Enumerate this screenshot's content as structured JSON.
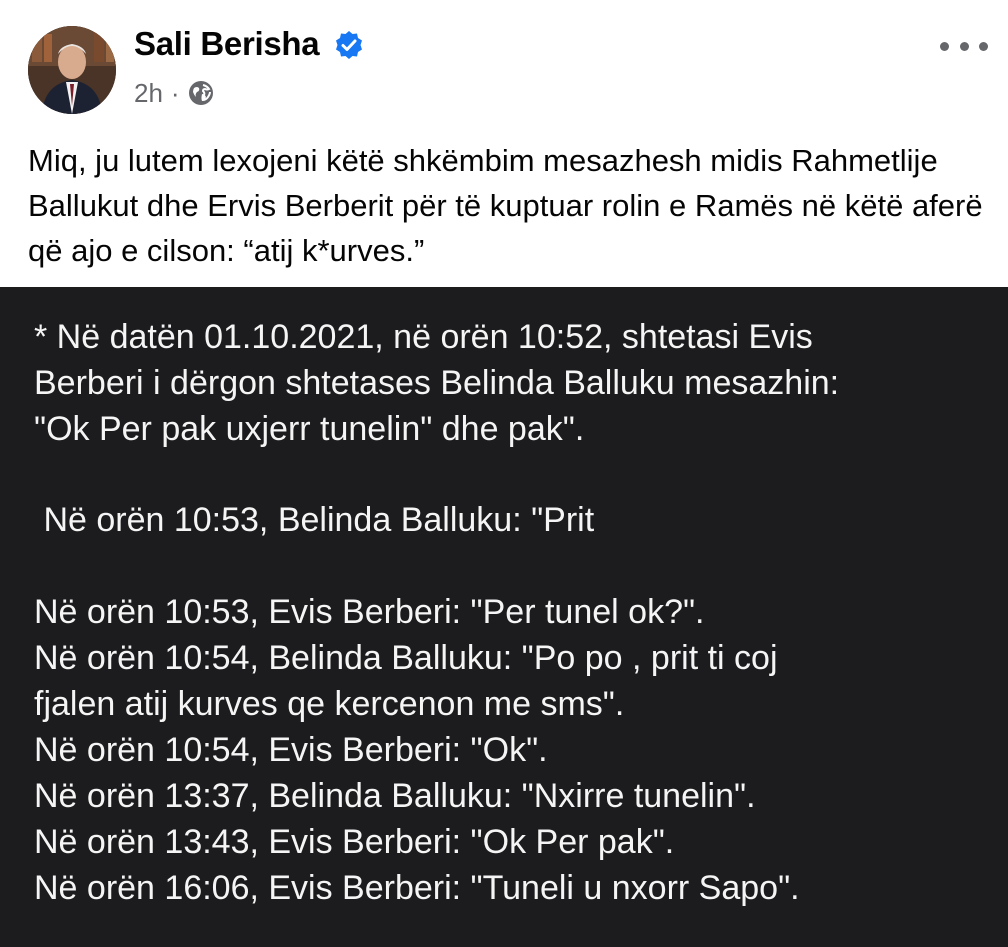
{
  "post": {
    "author": "Sali Berisha",
    "time": "2h",
    "separator": "·",
    "caption": "Miq, ju lutem lexojeni këtë shkëmbim mesazhesh midis Rahmetlije Ballukut dhe Ervis Berberit për të kuptuar rolin e Ramës në këtë aferë që ajo e cilson: “atij k*urves.”",
    "icons": {
      "verified": "verified-badge-icon",
      "audience": "globe-icon",
      "menu": "more-options-icon"
    },
    "colors": {
      "verified": "#1877f2",
      "meta": "#65676b",
      "image_background": "#1c1c1e"
    }
  },
  "image_text": {
    "lines": [
      "* Në datën 01.10.2021, në orën 10:52, shtetasi Evis",
      "Berberi i dërgon shtetases Belinda Balluku mesazhin:",
      "\"Ok Per pak uxjerr tunelin\" dhe pak\".",
      " Në orën 10:53, Belinda Balluku: \"Prit",
      "Në orën 10:53, Evis Berberi: \"Per tunel ok?\".",
      "Në orën 10:54, Belinda Balluku: \"Po po , prit ti coj",
      "fjalen atij kurves qe kercenon me sms\".",
      "Në orën 10:54, Evis Berberi: \"Ok\".",
      "Në orën 13:37, Belinda Balluku: \"Nxirre tunelin\".",
      "Në orën 13:43, Evis Berberi: \"Ok Per pak\".",
      "Në orën 16:06, Evis Berberi: \"Tuneli u nxorr Sapo\"."
    ]
  }
}
